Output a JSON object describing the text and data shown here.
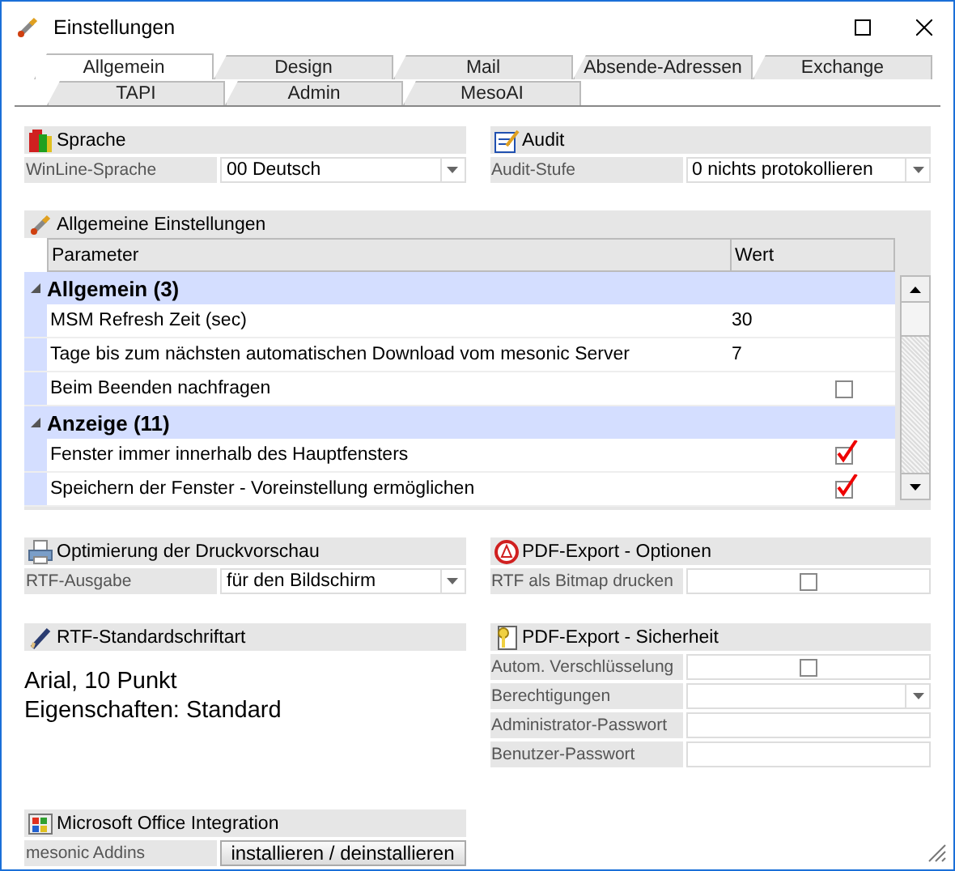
{
  "window": {
    "title": "Einstellungen"
  },
  "tab_rows": [
    [
      {
        "label": "Allgemein",
        "selected": true
      },
      {
        "label": "Design",
        "selected": false
      },
      {
        "label": "Mail",
        "selected": false
      },
      {
        "label": "Absende-Adressen",
        "selected": false
      },
      {
        "label": "Exchange",
        "selected": false
      }
    ],
    [
      {
        "label": "TAPI",
        "selected": false
      },
      {
        "label": "Admin",
        "selected": false
      },
      {
        "label": "MesoAI",
        "selected": false
      }
    ]
  ],
  "sprache": {
    "title": "Sprache",
    "rows": [
      {
        "kind": "dropdown",
        "label": "WinLine-Sprache",
        "value": "00 Deutsch"
      }
    ]
  },
  "audit": {
    "title": "Audit",
    "rows": [
      {
        "kind": "dropdown",
        "label": "Audit-Stufe",
        "value": "0 nichts protokollieren"
      }
    ]
  },
  "general_settings": {
    "title": "Allgemeine Einstellungen",
    "columns": [
      "Parameter",
      "Wert"
    ],
    "groups": [
      {
        "title": "Allgemein (3)",
        "expanded": true,
        "items": [
          {
            "kind": "text",
            "label": "MSM Refresh Zeit (sec)",
            "value": "30"
          },
          {
            "kind": "text",
            "label": "Tage bis zum nächsten automatischen Download vom mesonic Server",
            "value": "7"
          },
          {
            "kind": "checkbox",
            "label": "Beim Beenden nachfragen",
            "checked": false
          }
        ]
      },
      {
        "title": "Anzeige (11)",
        "expanded": true,
        "items": [
          {
            "kind": "checkbox",
            "label": "Fenster immer innerhalb des Hauptfensters",
            "checked": true
          },
          {
            "kind": "checkbox",
            "label": "Speichern der Fenster - Voreinstellung ermöglichen",
            "checked": true
          }
        ]
      }
    ]
  },
  "druckvorschau": {
    "title": "Optimierung der Druckvorschau",
    "rows": [
      {
        "kind": "dropdown",
        "label": "RTF-Ausgabe",
        "value": "für den Bildschirm"
      }
    ]
  },
  "rtf_font": {
    "title": "RTF-Standardschriftart",
    "lines": [
      "Arial, 10 Punkt",
      "Eigenschaften: Standard"
    ]
  },
  "office": {
    "title": "Microsoft Office Integration",
    "rows": [
      {
        "kind": "button",
        "label": "mesonic Addins",
        "value": "installieren / deinstallieren"
      }
    ]
  },
  "pdf_options": {
    "title": "PDF-Export - Optionen",
    "rows": [
      {
        "kind": "checkbox",
        "label": "RTF als Bitmap drucken",
        "checked": false
      }
    ]
  },
  "pdf_security": {
    "title": "PDF-Export - Sicherheit",
    "rows": [
      {
        "kind": "checkbox",
        "label": "Autom. Verschlüsselung",
        "checked": false
      },
      {
        "kind": "dropdown",
        "label": "Berechtigungen"
      },
      {
        "kind": "text",
        "label": "Administrator-Passwort"
      },
      {
        "kind": "text",
        "label": "Benutzer-Passwort"
      }
    ]
  }
}
